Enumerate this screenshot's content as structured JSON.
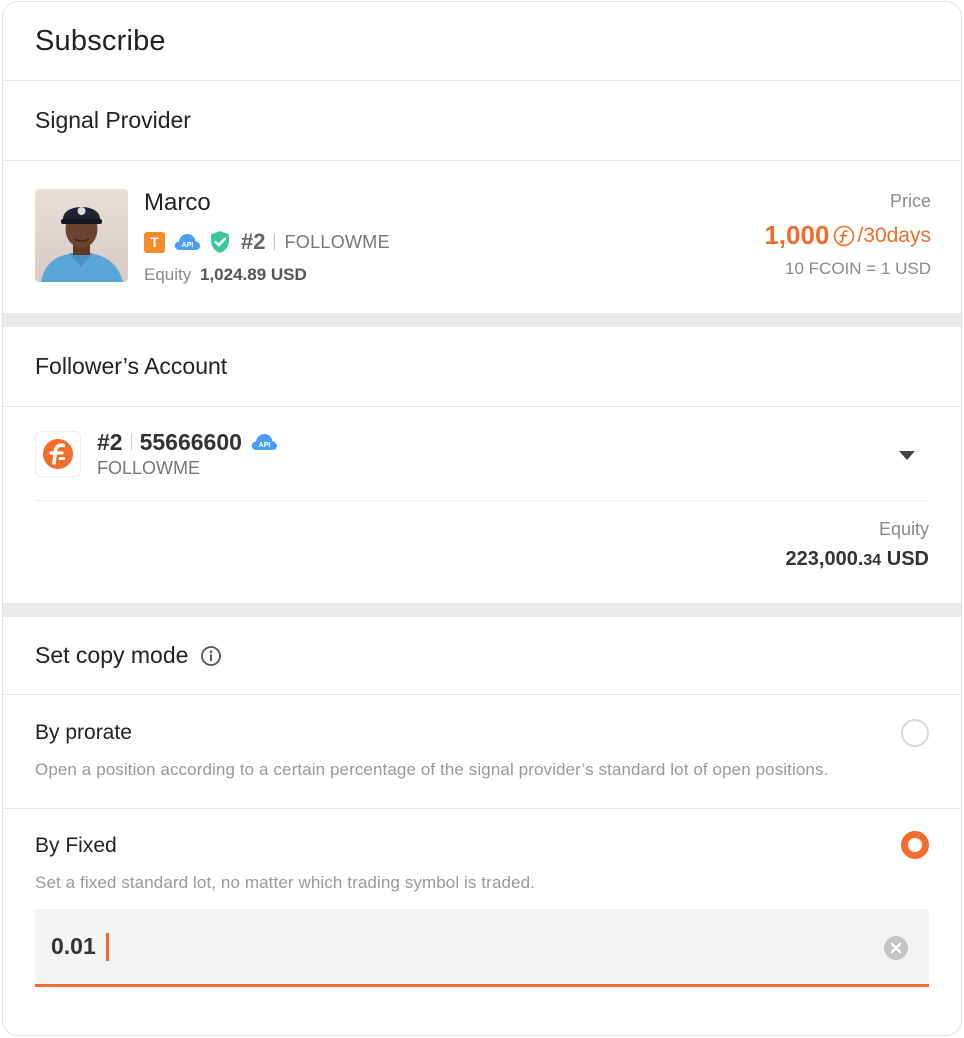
{
  "header": {
    "title": "Subscribe"
  },
  "signal_provider": {
    "section_title": "Signal Provider",
    "name": "Marco",
    "badge_letter": "T",
    "api_label": "API",
    "rank": "#2",
    "broker": "FOLLOWME",
    "equity_label": "Equity",
    "equity_value": "1,024.89 USD",
    "price_label": "Price",
    "price_value": "1,000",
    "price_period": "/30days",
    "rate_text": "10 FCOIN = 1 USD",
    "icons": [
      "avatar-photo",
      "t-badge-icon",
      "api-cloud-icon",
      "verified-shield-icon",
      "fcoin-icon"
    ]
  },
  "follower_account": {
    "section_title": "Follower’s Account",
    "rank": "#2",
    "account_number": "55666600",
    "api_label": "API",
    "broker": "FOLLOWME",
    "equity_label": "Equity",
    "equity_value_main": "223,000.",
    "equity_value_cents": "34",
    "equity_currency": " USD",
    "icons": [
      "followme-logo-icon",
      "api-cloud-icon",
      "dropdown-caret-icon"
    ]
  },
  "copy_mode": {
    "section_title": "Set copy mode",
    "options": [
      {
        "title": "By prorate",
        "description": "Open a position according to a certain percentage of the signal provider’s standard lot of open positions.",
        "selected": false
      },
      {
        "title": "By Fixed",
        "description": "Set a fixed standard lot, no matter which trading symbol is traded.",
        "selected": true
      }
    ],
    "fixed_lot_value": "0.01",
    "icons": [
      "info-icon",
      "clear-icon"
    ]
  },
  "colors": {
    "accent": "#f26c2c",
    "badge_orange": "#f28c28",
    "api_blue": "#4a9ff5",
    "shield_green": "#3cc7a0",
    "divider_gray": "#ebebeb"
  }
}
